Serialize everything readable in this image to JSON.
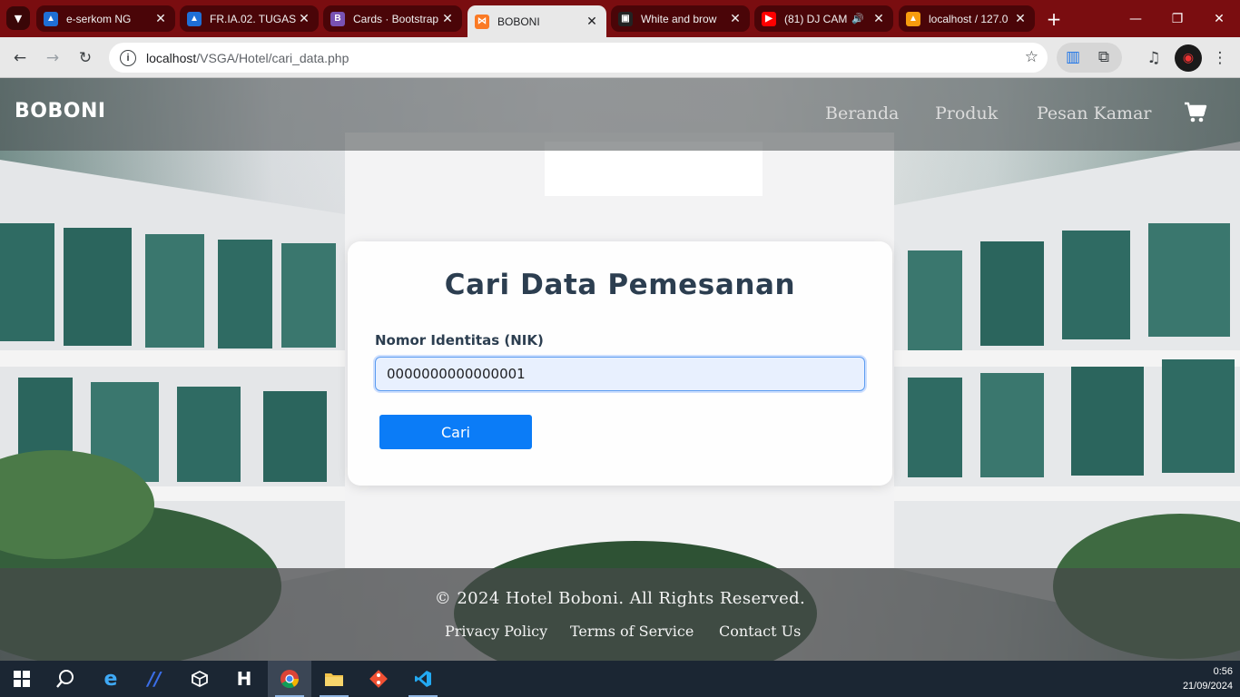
{
  "browser": {
    "tabs": [
      {
        "title": "e-serkom NG",
        "icon": "triangle-logo-icon",
        "color": "#1f6fd6",
        "active": false
      },
      {
        "title": "FR.IA.02. TUGAS",
        "icon": "triangle-logo-icon",
        "color": "#1f6fd6",
        "active": false
      },
      {
        "title": "Cards · Bootstrap",
        "icon": "bootstrap-logo-icon",
        "color": "#7952b3",
        "active": false
      },
      {
        "title": "BOBONI",
        "icon": "xampp-logo-icon",
        "color": "#fb7a24",
        "active": true
      },
      {
        "title": "White and brow",
        "icon": "web-page-icon",
        "color": "#222222",
        "active": false
      },
      {
        "title": "(81) DJ CAM",
        "icon": "youtube-logo-icon",
        "color": "#ff0000",
        "active": false
      },
      {
        "title": "localhost / 127.0",
        "icon": "phpmyadmin-logo-icon",
        "color": "#f89c0e",
        "active": false
      }
    ],
    "url_host": "localhost",
    "url_path": "/VSGA/Hotel/cari_data.php"
  },
  "site": {
    "brand": "BOBONI",
    "nav": [
      "Beranda",
      "Produk",
      "Pesan Kamar"
    ],
    "cart_icon": "cart-icon"
  },
  "form": {
    "title": "Cari Data Pemesanan",
    "label": "Nomor Identitas (NIK)",
    "value": "0000000000000001",
    "button": "Cari"
  },
  "footer": {
    "copyright": "© 2024 Hotel Boboni. All Rights Reserved.",
    "links": [
      "Privacy Policy",
      "Terms of Service",
      "Contact Us"
    ]
  },
  "taskbar": {
    "icons": [
      "windows-start-icon",
      "search-icon",
      "internet-explorer-icon",
      "visual-studio-icon",
      "unity-icon",
      "herd-icon",
      "chrome-icon",
      "file-explorer-icon",
      "git-icon",
      "vscode-icon"
    ],
    "time": "0:56",
    "date": "21/09/2024"
  },
  "colors": {
    "primary_button": "#0b7cf7",
    "title_text": "#2c3e50",
    "tab_strip": "#7a0d10"
  }
}
